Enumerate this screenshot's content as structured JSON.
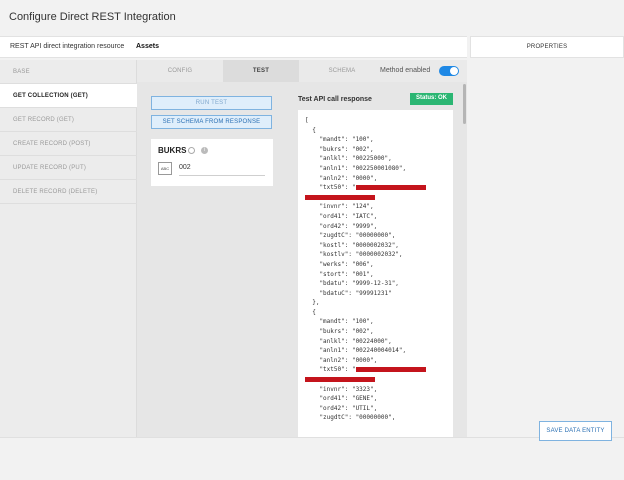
{
  "window": {
    "title": "Configure Direct REST Integration"
  },
  "resource": {
    "label": "REST API direct integration resource",
    "value": "Assets"
  },
  "properties_tab": "PROPERTIES",
  "nav": {
    "items": [
      {
        "label": "BASE",
        "active": false
      },
      {
        "label": "GET COLLECTION (GET)",
        "active": true
      },
      {
        "label": "GET RECORD (GET)",
        "active": false
      },
      {
        "label": "CREATE RECORD (POST)",
        "active": false
      },
      {
        "label": "UPDATE RECORD (PUT)",
        "active": false
      },
      {
        "label": "DELETE RECORD (DELETE)",
        "active": false
      }
    ]
  },
  "tabs": [
    {
      "label": "CONFIG",
      "active": false
    },
    {
      "label": "TEST",
      "active": true
    },
    {
      "label": "SCHEMA",
      "active": false
    }
  ],
  "method_enabled": {
    "label": "Method enabled",
    "on": true
  },
  "buttons": {
    "run_test": "RUN TEST",
    "set_schema": "SET SCHEMA FROM RESPONSE",
    "save": "SAVE DATA ENTITY"
  },
  "param": {
    "name": "BUKRS",
    "type_icon": "ABC",
    "value": "002"
  },
  "response": {
    "title": "Test API call response",
    "status": "Status: OK",
    "lines": [
      "[",
      "  {",
      "    \"mandt\": \"100\",",
      "    \"bukrs\": \"002\",",
      "    \"anlkl\": \"00225000\",",
      "    \"anln1\": \"002250001080\",",
      "    \"anln2\": \"0000\",",
      "    \"txt50\": \"",
      "",
      "    \"invnr\": \"124\",",
      "    \"ord41\": \"IATC\",",
      "    \"ord42\": \"9999\",",
      "    \"zugdtC\": \"00000000\",",
      "    \"kostl\": \"0000002032\",",
      "    \"kostlv\": \"0000002032\",",
      "    \"werks\": \"006\",",
      "    \"stort\": \"001\",",
      "    \"bdatu\": \"9999-12-31\",",
      "    \"bdatuC\": \"99991231\"",
      "  },",
      "  {",
      "    \"mandt\": \"100\",",
      "    \"bukrs\": \"002\",",
      "    \"anlkl\": \"00224000\",",
      "    \"anln1\": \"002240004014\",",
      "    \"anln2\": \"0000\",",
      "    \"txt50\": \"",
      "",
      "    \"invnr\": \"3323\",",
      "    \"ord41\": \"GENE\",",
      "    \"ord42\": \"UTIL\",",
      "    \"zugdtC\": \"00000000\","
    ],
    "redacted_lines": [
      7,
      8,
      26,
      27
    ]
  },
  "colors": {
    "accent": "#1e88e5",
    "status_ok": "#2bb673",
    "redaction": "#c4141c"
  }
}
